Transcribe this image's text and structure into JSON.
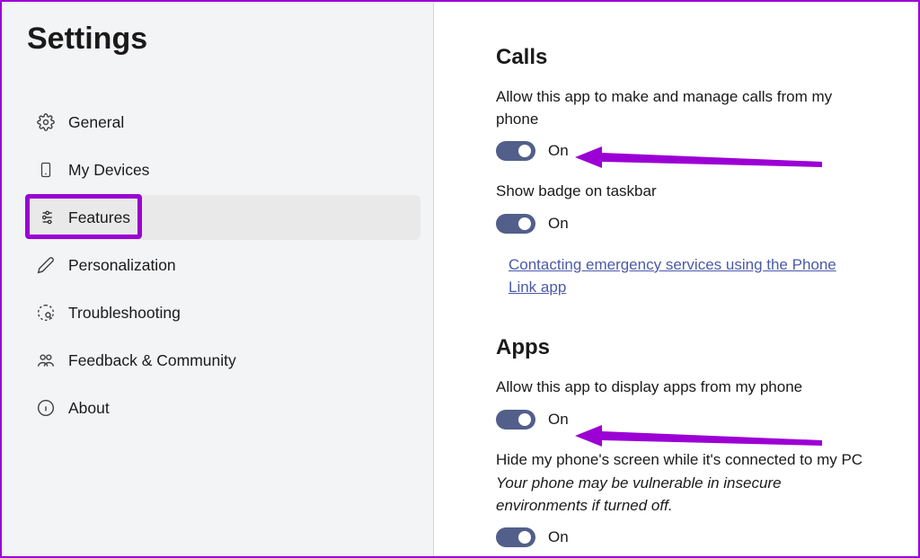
{
  "page": {
    "title": "Settings"
  },
  "sidebar": {
    "items": [
      {
        "label": "General"
      },
      {
        "label": "My Devices"
      },
      {
        "label": "Features"
      },
      {
        "label": "Personalization"
      },
      {
        "label": "Troubleshooting"
      },
      {
        "label": "Feedback & Community"
      },
      {
        "label": "About"
      }
    ]
  },
  "content": {
    "sections": {
      "calls": {
        "title": "Calls",
        "opt1": {
          "desc": "Allow this app to make and manage calls from my phone",
          "state": "On"
        },
        "opt2": {
          "desc": "Show badge on taskbar",
          "state": "On"
        },
        "link": "Contacting emergency services using the Phone Link app"
      },
      "apps": {
        "title": "Apps",
        "opt1": {
          "desc": "Allow this app to display apps from my phone",
          "state": "On"
        },
        "opt2": {
          "desc": "Hide my phone's screen while it's connected to my PC",
          "warn": "Your phone may be vulnerable in insecure environments if turned off.",
          "state": "On"
        }
      }
    }
  }
}
